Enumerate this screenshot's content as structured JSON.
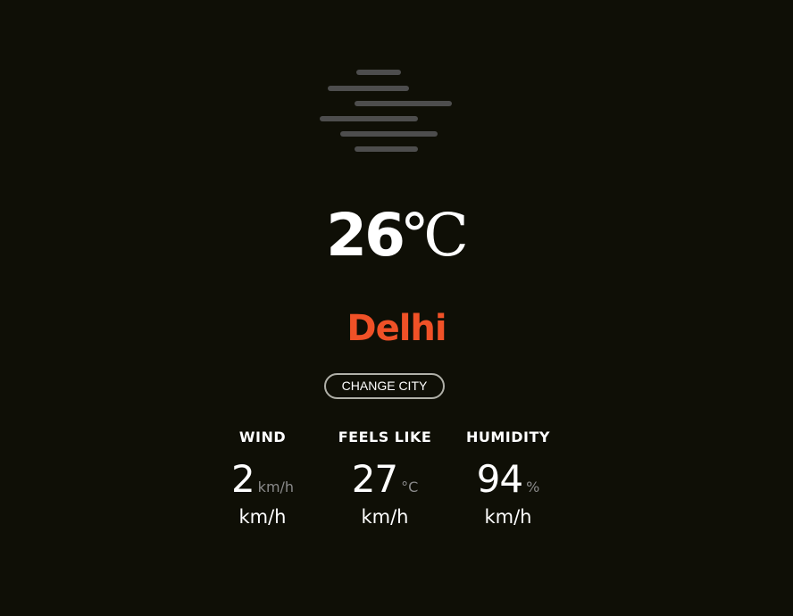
{
  "weather": {
    "icon": "fog-icon",
    "temperature_value": "26",
    "temperature_unit": "℃",
    "city": "Delhi"
  },
  "actions": {
    "change_city_label": "CHANGE CITY"
  },
  "stats": [
    {
      "label": "WIND",
      "value": "2",
      "unit": "km/h",
      "unit_below": "km/h"
    },
    {
      "label": "FEELS LIKE",
      "value": "27",
      "unit": "°C",
      "unit_below": "km/h"
    },
    {
      "label": "HUMIDITY",
      "value": "94",
      "unit": "%",
      "unit_below": "km/h"
    }
  ],
  "colors": {
    "background": "#0f0f06",
    "accent": "#f05127",
    "icon_bars": "#4d4d4d",
    "muted_unit": "#8a8a8a"
  }
}
